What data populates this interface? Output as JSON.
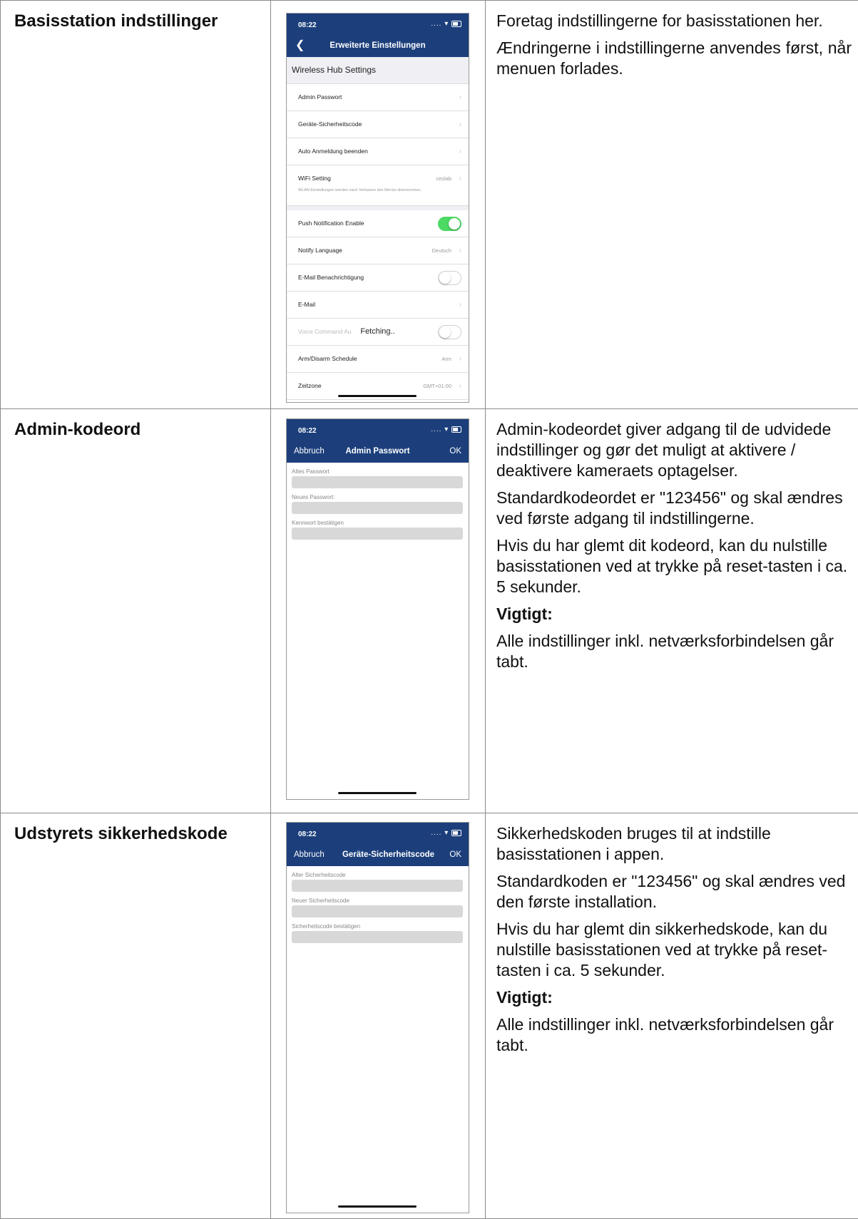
{
  "rows": [
    {
      "title": "Basisstation indstillinger",
      "phone": {
        "time": "08:22",
        "status": "....",
        "back_icon": "chevron-left-icon",
        "header_title": "Erweiterte Einstellungen",
        "section": "Wireless Hub Settings",
        "items": [
          {
            "label": "Admin Passwort",
            "value": ""
          },
          {
            "label": "Geräte-Sicherheitscode",
            "value": ""
          },
          {
            "label": "Auto Anmeldung beenden",
            "value": ""
          },
          {
            "label": "WiFi Setting",
            "value": "ceslab",
            "note": "WLAN Einstellungen werden nach Verlassen des Menüs übernommen."
          },
          {
            "label": "Push Notification Enable",
            "toggle": true
          },
          {
            "label": "Notify Language",
            "value": "Deutsch"
          },
          {
            "label": "E-Mail Benachrichtigung",
            "toggle": false
          },
          {
            "label": "E-Mail",
            "value": ""
          },
          {
            "label": "Voice Command Au",
            "toggle": false,
            "overlay": "Fetching.."
          },
          {
            "label": "Arm/Disarm Schedule",
            "value": "Arm"
          },
          {
            "label": "Zeitzone",
            "value": "GMT+01:00"
          }
        ]
      },
      "text": [
        "Foretag indstillingerne for basisstationen her.",
        "Ændringerne i indstillingerne anvendes først, når menuen forlades."
      ]
    },
    {
      "title": "Admin-kodeord",
      "phone": {
        "time": "08:22",
        "status": "....",
        "cancel": "Abbruch",
        "header_title": "Admin Passwort",
        "ok": "OK",
        "fields": [
          "Altes Passwort",
          "Neues Passwort:",
          "Kennwort bestätigen"
        ]
      },
      "text": [
        "Admin-kodeordet giver adgang til de udvidede indstillinger og gør det muligt at aktivere / deaktivere kameraets optagelser.",
        "Standardkodeordet er \"123456\" og skal ændres ved første adgang til indstillingerne.",
        "Hvis du har glemt dit kodeord, kan du nulstille basisstationen ved at trykke på reset-tasten i ca. 5 sekunder."
      ],
      "important": "Vigtigt:",
      "important_text": "Alle indstillinger inkl. netværksforbindelsen går tabt."
    },
    {
      "title": "Udstyrets sikkerhedskode",
      "phone": {
        "time": "08:22",
        "status": "....",
        "cancel": "Abbruch",
        "header_title": "Geräte-Sicherheitscode",
        "ok": "OK",
        "fields": [
          "Alter Sicherheitscode",
          "Neuer Sicherheitscode",
          "Sicherheitscode bestätigen"
        ]
      },
      "text": [
        "Sikkerhedskoden bruges til at indstille basisstationen i appen.",
        "Standardkoden er \"123456\" og skal ændres ved den første installation.",
        "Hvis du har glemt din sikkerhedskode, kan du nulstille basisstationen ved at trykke på reset-tasten i ca. 5 sekunder."
      ],
      "important": "Vigtigt:",
      "important_text": "Alle indstillinger inkl. netværksforbindelsen går tabt."
    }
  ]
}
